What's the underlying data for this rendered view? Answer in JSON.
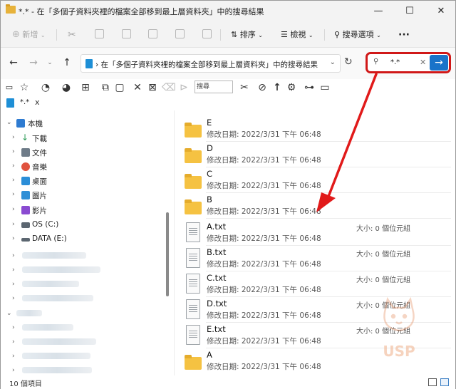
{
  "window": {
    "title": "*.* - 在「多個子資料夾裡的檔案全部移到最上層資料夾」中的搜尋結果",
    "controls": {
      "minimize": "—",
      "maximize": "☐",
      "close": "✕"
    }
  },
  "commandbar": {
    "new_label": "新增",
    "sort_label": "排序",
    "view_label": "檢視",
    "search_options_label": "搜尋選項",
    "more_label": "···"
  },
  "address": {
    "path": "在「多個子資料夾裡的檔案全部移到最上層資料夾」中的搜尋結果"
  },
  "search": {
    "value": "*.*"
  },
  "toolbar": {
    "search_placeholder": "搜尋"
  },
  "tab": {
    "label": "*.*",
    "close": "x"
  },
  "navpane": {
    "items": [
      {
        "label": "本機",
        "icon": "pc-icon",
        "color": "#2e7bd1"
      },
      {
        "label": "下載",
        "icon": "download-icon",
        "color": "#2a9a55"
      },
      {
        "label": "文件",
        "icon": "document-icon",
        "color": "#6e7b88"
      },
      {
        "label": "音樂",
        "icon": "music-icon",
        "color": "#e0533f"
      },
      {
        "label": "桌面",
        "icon": "desktop-icon",
        "color": "#2b8ed8"
      },
      {
        "label": "圖片",
        "icon": "picture-icon",
        "color": "#2f8fd6"
      },
      {
        "label": "影片",
        "icon": "video-icon",
        "color": "#8a4bd1"
      },
      {
        "label": "OS (C:)",
        "icon": "drive-icon",
        "color": "#5b6670"
      },
      {
        "label": "DATA (E:)",
        "icon": "drive-icon",
        "color": "#5b6670"
      }
    ]
  },
  "files": [
    {
      "name": "E",
      "type": "folder",
      "date": "修改日期: 2022/3/31 下午 06:48",
      "size": ""
    },
    {
      "name": "D",
      "type": "folder",
      "date": "修改日期: 2022/3/31 下午 06:48",
      "size": ""
    },
    {
      "name": "C",
      "type": "folder",
      "date": "修改日期: 2022/3/31 下午 06:48",
      "size": ""
    },
    {
      "name": "B",
      "type": "folder",
      "date": "修改日期: 2022/3/31 下午 06:48",
      "size": ""
    },
    {
      "name": "A.txt",
      "type": "file",
      "date": "修改日期: 2022/3/31 下午 06:48",
      "size": "大小: 0 個位元組"
    },
    {
      "name": "B.txt",
      "type": "file",
      "date": "修改日期: 2022/3/31 下午 06:48",
      "size": "大小: 0 個位元組"
    },
    {
      "name": "C.txt",
      "type": "file",
      "date": "修改日期: 2022/3/31 下午 06:48",
      "size": "大小: 0 個位元組"
    },
    {
      "name": "D.txt",
      "type": "file",
      "date": "修改日期: 2022/3/31 下午 06:48",
      "size": "大小: 0 個位元組"
    },
    {
      "name": "E.txt",
      "type": "file",
      "date": "修改日期: 2022/3/31 下午 06:48",
      "size": "大小: 0 個位元組"
    },
    {
      "name": "A",
      "type": "folder",
      "date": "修改日期: 2022/3/31 下午 06:48",
      "size": ""
    }
  ],
  "status": {
    "count": "10 個項目"
  },
  "colors": {
    "highlight": "#d01818",
    "accent": "#1a73c9",
    "folder": "#f5c242"
  },
  "watermark": {
    "text": "USP"
  }
}
